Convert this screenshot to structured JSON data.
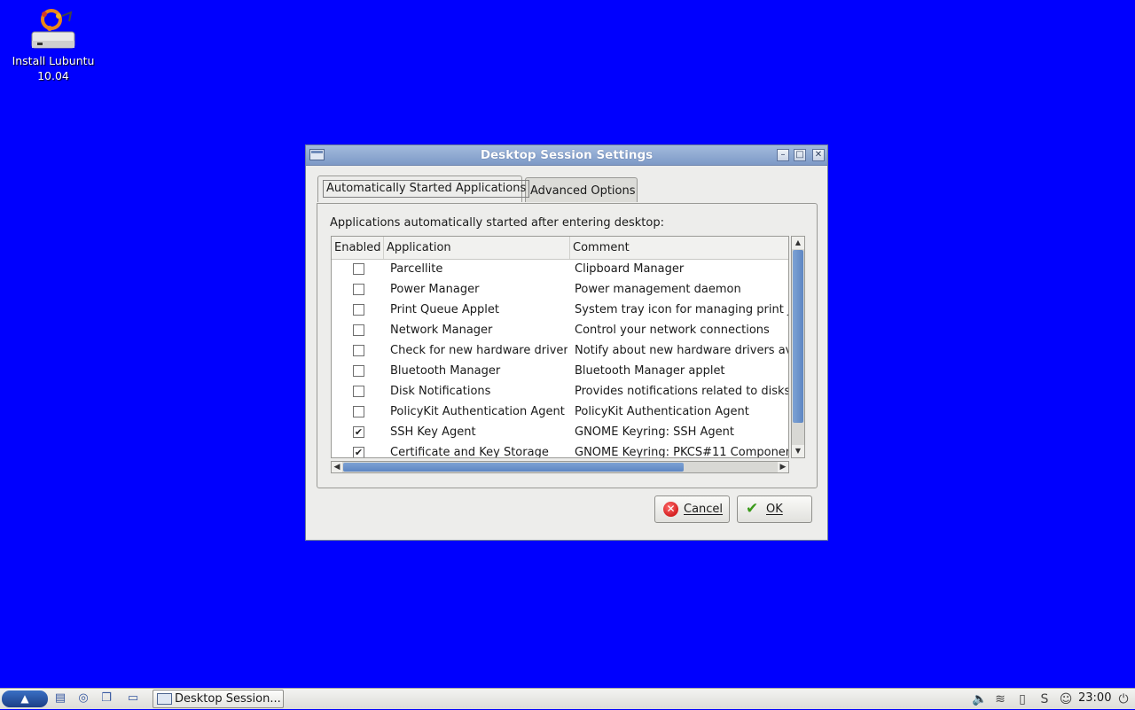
{
  "desktop": {
    "icon_label_line1": "Install Lubuntu",
    "icon_label_line2": "10.04"
  },
  "window": {
    "title": "Desktop Session Settings",
    "tabs": [
      {
        "label": "Automatically Started Applications",
        "active": true
      },
      {
        "label": "Advanced Options",
        "active": false
      }
    ],
    "description": "Applications automatically started after entering desktop:",
    "columns": [
      "Enabled",
      "Application",
      "Comment"
    ],
    "rows": [
      {
        "enabled": false,
        "application": "Parcellite",
        "comment": "Clipboard Manager"
      },
      {
        "enabled": false,
        "application": "Power Manager",
        "comment": "Power management daemon"
      },
      {
        "enabled": false,
        "application": "Print Queue Applet",
        "comment": "System tray icon for managing print jo"
      },
      {
        "enabled": false,
        "application": "Network Manager",
        "comment": "Control your network connections"
      },
      {
        "enabled": false,
        "application": "Check for new hardware drivers",
        "comment": "Notify about new hardware drivers ava"
      },
      {
        "enabled": false,
        "application": "Bluetooth Manager",
        "comment": "Bluetooth Manager applet"
      },
      {
        "enabled": false,
        "application": "Disk Notifications",
        "comment": "Provides notifications related to disks"
      },
      {
        "enabled": false,
        "application": "PolicyKit Authentication Agent",
        "comment": "PolicyKit Authentication Agent"
      },
      {
        "enabled": true,
        "application": "SSH Key Agent",
        "comment": "GNOME Keyring: SSH Agent"
      },
      {
        "enabled": true,
        "application": "Certificate and Key Storage",
        "comment": "GNOME Keyring: PKCS#11 Componen"
      }
    ],
    "buttons": {
      "cancel": "Cancel",
      "ok": "OK"
    }
  },
  "taskbar": {
    "task_label": "Desktop Session...",
    "clock": "23:00"
  },
  "colors": {
    "desktop_bg": "#0000fe",
    "titlebar": "#8aa5cf",
    "scroll_thumb": "#6b91ca"
  }
}
